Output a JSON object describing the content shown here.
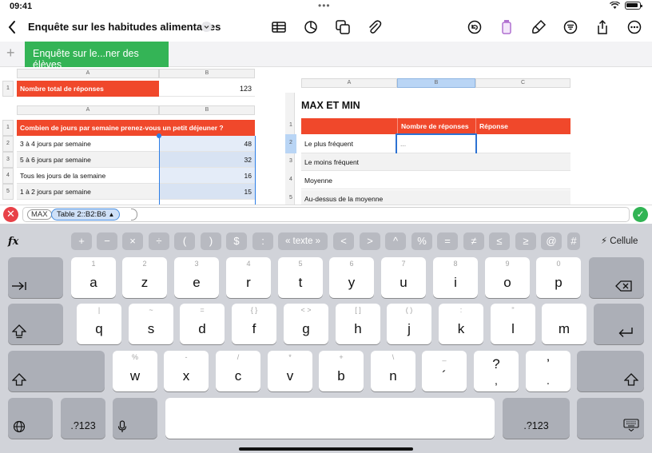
{
  "status_bar": {
    "time": "09:41"
  },
  "toolbar": {
    "title": "Enquête sur les habitudes alimentaires"
  },
  "sheet_tab": {
    "label": "Enquête sur le...ner des élèves"
  },
  "table1": {
    "col_a": "A",
    "col_b": "B",
    "row_num": "1",
    "label": "Nombre total de réponses",
    "value": "123"
  },
  "table2": {
    "col_a": "A",
    "col_b": "B",
    "header": "Combien de jours par semaine prenez-vous un petit déjeuner ?",
    "rows": [
      {
        "num": "1",
        "label": "",
        "value": ""
      },
      {
        "num": "2",
        "label": "3 à 4 jours par semaine",
        "value": "48"
      },
      {
        "num": "3",
        "label": "5 à 6 jours par semaine",
        "value": "32"
      },
      {
        "num": "4",
        "label": "Tous les jours de la semaine",
        "value": "16"
      },
      {
        "num": "5",
        "label": "1 à 2 jours par semaine",
        "value": "15"
      }
    ]
  },
  "table3": {
    "title": "MAX ET MIN",
    "col_a": "A",
    "col_b": "B",
    "col_c": "C",
    "header_b": "Nombre de réponses",
    "header_c": "Réponse",
    "rows": [
      {
        "num": "1",
        "label": ""
      },
      {
        "num": "2",
        "label": "Le plus fréquent",
        "value": "..."
      },
      {
        "num": "3",
        "label": "Le moins fréquent"
      },
      {
        "num": "4",
        "label": "Moyenne"
      },
      {
        "num": "5",
        "label": "Au-dessus de la moyenne"
      }
    ]
  },
  "formula": {
    "function": "MAX",
    "range": "Table 2::B2:B6",
    "range_arrow": "▲"
  },
  "keyboard": {
    "fx": "fx",
    "operators": [
      "+",
      "−",
      "×",
      "÷",
      "(",
      ")",
      "$",
      ":",
      "« texte »",
      "<",
      ">",
      "^",
      "%",
      "=",
      "≠",
      "≤",
      "≥",
      "@",
      "#"
    ],
    "cell_button": "Cellule",
    "row1": [
      {
        "main": "a",
        "sub": "1"
      },
      {
        "main": "z",
        "sub": "2"
      },
      {
        "main": "e",
        "sub": "3"
      },
      {
        "main": "r",
        "sub": "4"
      },
      {
        "main": "t",
        "sub": "5"
      },
      {
        "main": "y",
        "sub": "6"
      },
      {
        "main": "u",
        "sub": "7"
      },
      {
        "main": "i",
        "sub": "8"
      },
      {
        "main": "o",
        "sub": "9"
      },
      {
        "main": "p",
        "sub": "0"
      }
    ],
    "row2": [
      {
        "main": "q",
        "sub": "|"
      },
      {
        "main": "s",
        "sub": "~"
      },
      {
        "main": "d",
        "sub": "="
      },
      {
        "main": "f",
        "sub": "{ }"
      },
      {
        "main": "g",
        "sub": "< >"
      },
      {
        "main": "h",
        "sub": "[ ]"
      },
      {
        "main": "j",
        "sub": "( )"
      },
      {
        "main": "k",
        "sub": ":"
      },
      {
        "main": "l",
        "sub": "\""
      },
      {
        "main": "m",
        "sub": ""
      }
    ],
    "row3": [
      {
        "main": "w",
        "sub": "%"
      },
      {
        "main": "x",
        "sub": "-"
      },
      {
        "main": "c",
        "sub": "/"
      },
      {
        "main": "v",
        "sub": "*"
      },
      {
        "main": "b",
        "sub": "+"
      },
      {
        "main": "n",
        "sub": "\\"
      },
      {
        "main": "´",
        "sub": "_"
      },
      {
        "main": "?",
        "sub": ","
      },
      {
        "main": "’",
        "sub": "."
      }
    ],
    "num_key": ".?123"
  }
}
